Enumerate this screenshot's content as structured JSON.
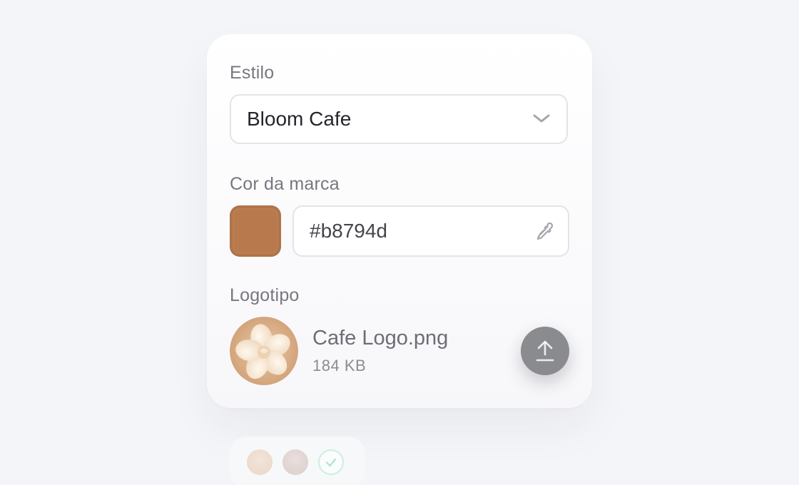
{
  "form": {
    "style_label": "Estilo",
    "style_value": "Bloom Cafe",
    "brand_color_label": "Cor da marca",
    "brand_color_hex": "#b8794d",
    "logo_label": "Logotipo",
    "logo_file_name": "Cafe Logo.png",
    "logo_file_size": "184 KB"
  },
  "icons": {
    "select_chevron": "chevron-down-icon",
    "color_picker": "eyedropper-icon",
    "upload": "upload-icon",
    "step_done": "check-icon"
  },
  "colors": {
    "brand": "#b8794d",
    "upload_button": "#8a8b8f",
    "step_check": "#a8e6d2"
  }
}
